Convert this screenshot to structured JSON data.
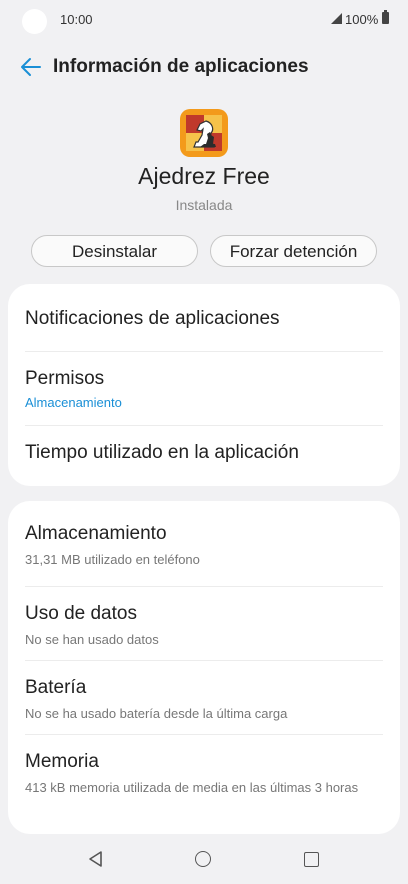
{
  "status_bar": {
    "time": "10:00",
    "battery": "100%"
  },
  "header": {
    "title": "Información de aplicaciones",
    "back_icon": "back-arrow-icon"
  },
  "app": {
    "name": "Ajedrez Free",
    "status": "Instalada",
    "icon": "chess-app-icon"
  },
  "buttons": {
    "uninstall": "Desinstalar",
    "force_stop": "Forzar detención"
  },
  "section1": [
    {
      "label": "Notificaciones de aplicaciones"
    },
    {
      "label": "Permisos",
      "sub": "Almacenamiento"
    },
    {
      "label": "Tiempo utilizado en la aplicación"
    }
  ],
  "section2": [
    {
      "label": "Almacenamiento",
      "sub": "31,31 MB utilizado en teléfono"
    },
    {
      "label": "Uso de datos",
      "sub": "No se han usado datos"
    },
    {
      "label": "Batería",
      "sub": "No se ha usado batería desde la última carga"
    },
    {
      "label": "Memoria",
      "sub": "413 kB memoria utilizada de media en las últimas 3 horas"
    }
  ],
  "colors": {
    "accent": "#1a8fd6",
    "background": "#f1f1f3"
  }
}
